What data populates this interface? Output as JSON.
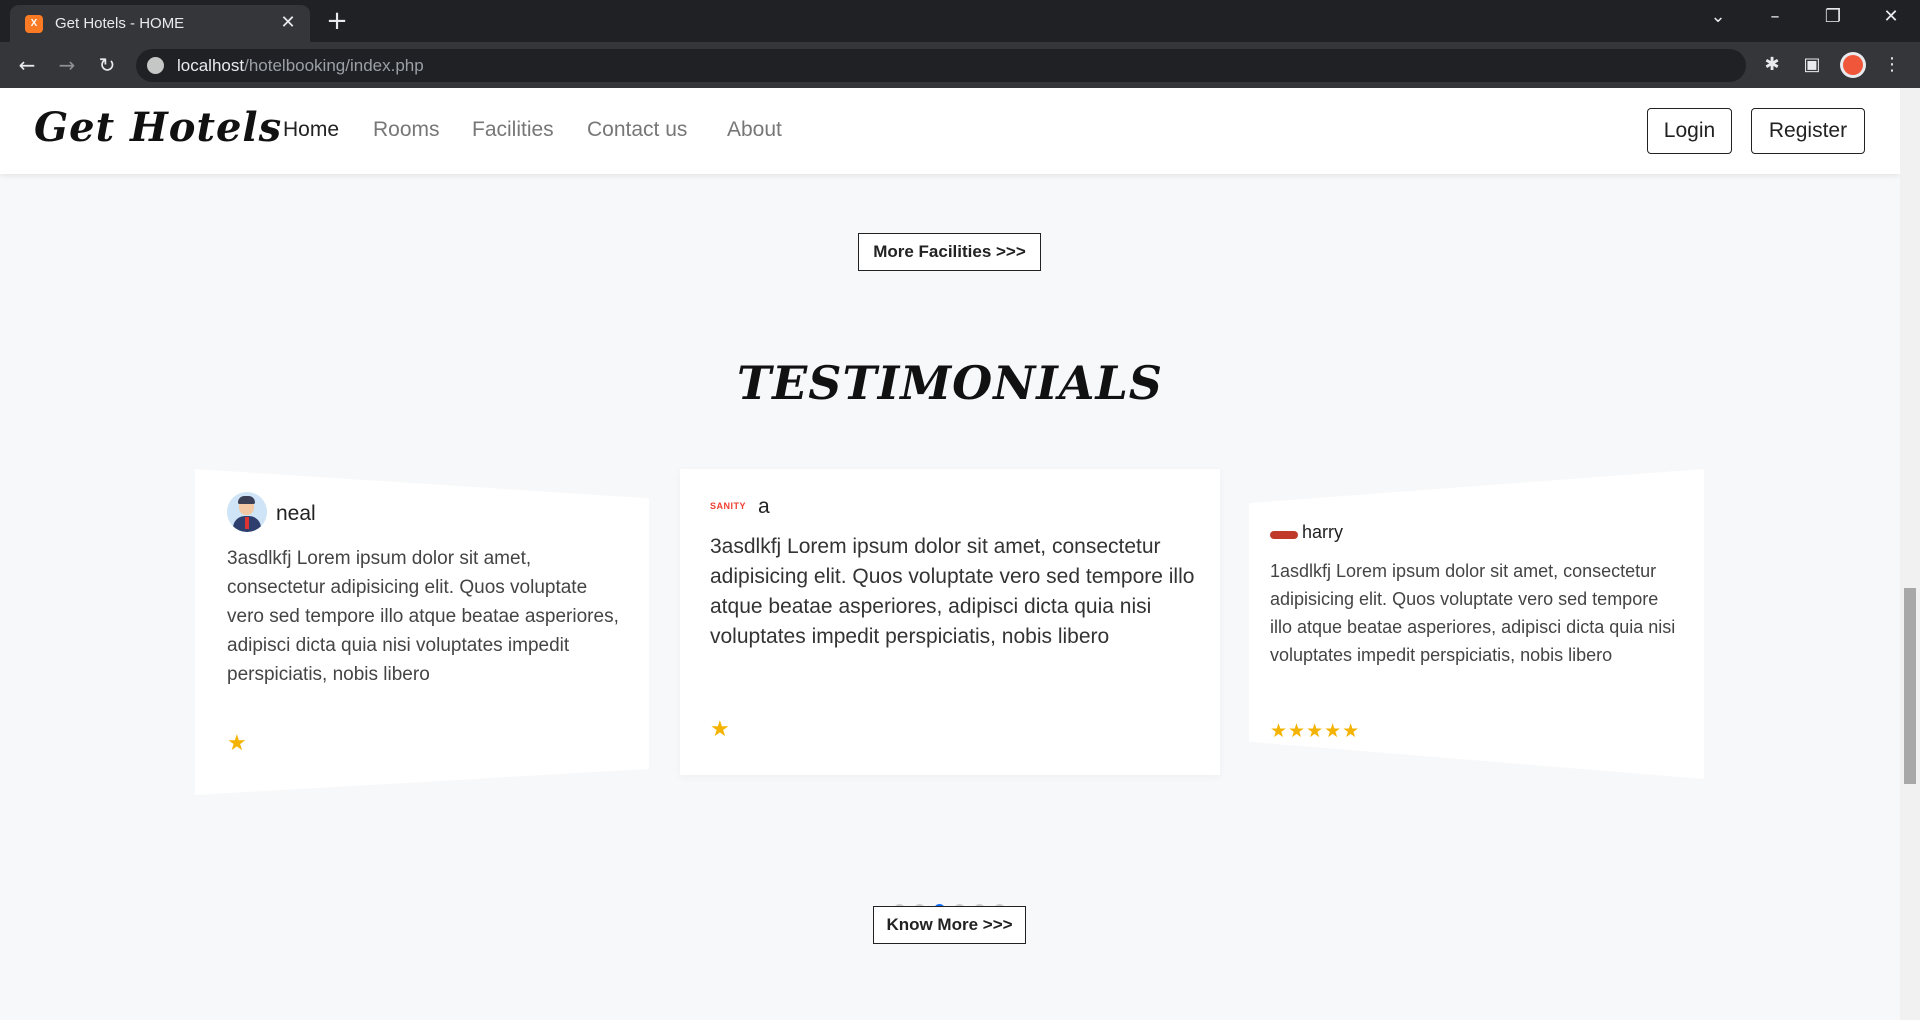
{
  "browser": {
    "tab_title": "Get Hotels - HOME",
    "favicon_label": "X",
    "url_host": "localhost",
    "url_path": "/hotelbooking/index.php"
  },
  "navbar": {
    "brand": "Get Hotels",
    "links": [
      {
        "label": "Home",
        "active": true
      },
      {
        "label": "Rooms",
        "active": false
      },
      {
        "label": "Facilities",
        "active": false
      },
      {
        "label": "Contact us",
        "active": false
      },
      {
        "label": "About",
        "active": false
      }
    ],
    "login_label": "Login",
    "register_label": "Register"
  },
  "facilities": {
    "more_label": "More Facilities >>>"
  },
  "testimonials": {
    "title": "TESTIMONIALS",
    "items": [
      {
        "name": "neal",
        "avatar": "person-avatar-icon",
        "review": "3asdlkfj Lorem ipsum dolor sit amet, consectetur adipisicing elit. Quos voluptate vero sed tempore illo atque beatae asperiores, adipisci dicta quia nisi voluptates impedit perspiciatis, nobis libero",
        "rating": 1,
        "stars": "★"
      },
      {
        "name": "a",
        "avatar": "sanity-logo",
        "logo_text": "SANITY",
        "review": "3asdlkfj Lorem ipsum dolor sit amet, consectetur adipisicing elit. Quos voluptate vero sed tempore illo atque beatae asperiores, adipisci dicta quia nisi voluptates impedit perspiciatis, nobis libero",
        "rating": 1,
        "stars": "★"
      },
      {
        "name": "harry",
        "avatar": "red-logo-icon",
        "review": "1asdlkfj Lorem ipsum dolor sit amet, consectetur adipisicing elit. Quos voluptate vero sed tempore illo atque beatae asperiores, adipisci dicta quia nisi voluptates impedit perspiciatis, nobis libero",
        "rating": 5,
        "stars": "★★★★★"
      }
    ],
    "pagination": {
      "count": 6,
      "active_index": 2
    },
    "colors": {
      "star": "#f5b301",
      "active_dot": "#0d6efd"
    }
  },
  "about": {
    "know_more_label": "Know More >>>"
  }
}
